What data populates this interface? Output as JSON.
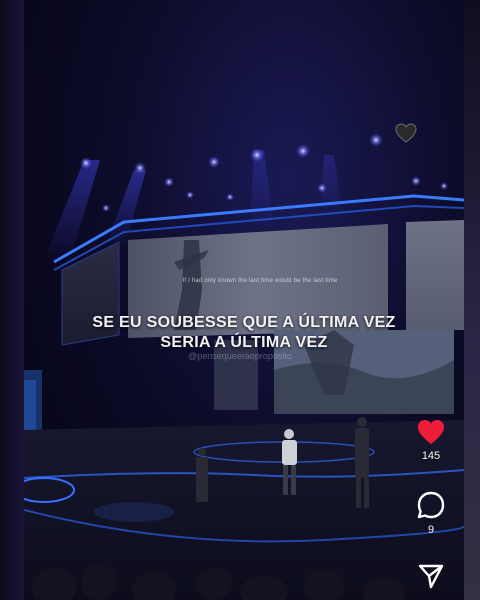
{
  "caption": {
    "line1": "SE EU SOUBESSE QUE A ÚLTIMA VEZ",
    "line2": "SERIA A ÚLTIMA VEZ"
  },
  "screen_lyric": "If I had only known the last time would be the last time",
  "watermark": "@pensequeeraoproposito",
  "actions": {
    "like_count": "145",
    "comment_count": "9"
  },
  "colors": {
    "like": "#ee1d3a",
    "stage_neon": "#2f6dff",
    "icon": "#ffffff"
  },
  "icons": [
    "heart-outline-icon",
    "like-heart-icon",
    "comment-icon",
    "share-icon"
  ]
}
